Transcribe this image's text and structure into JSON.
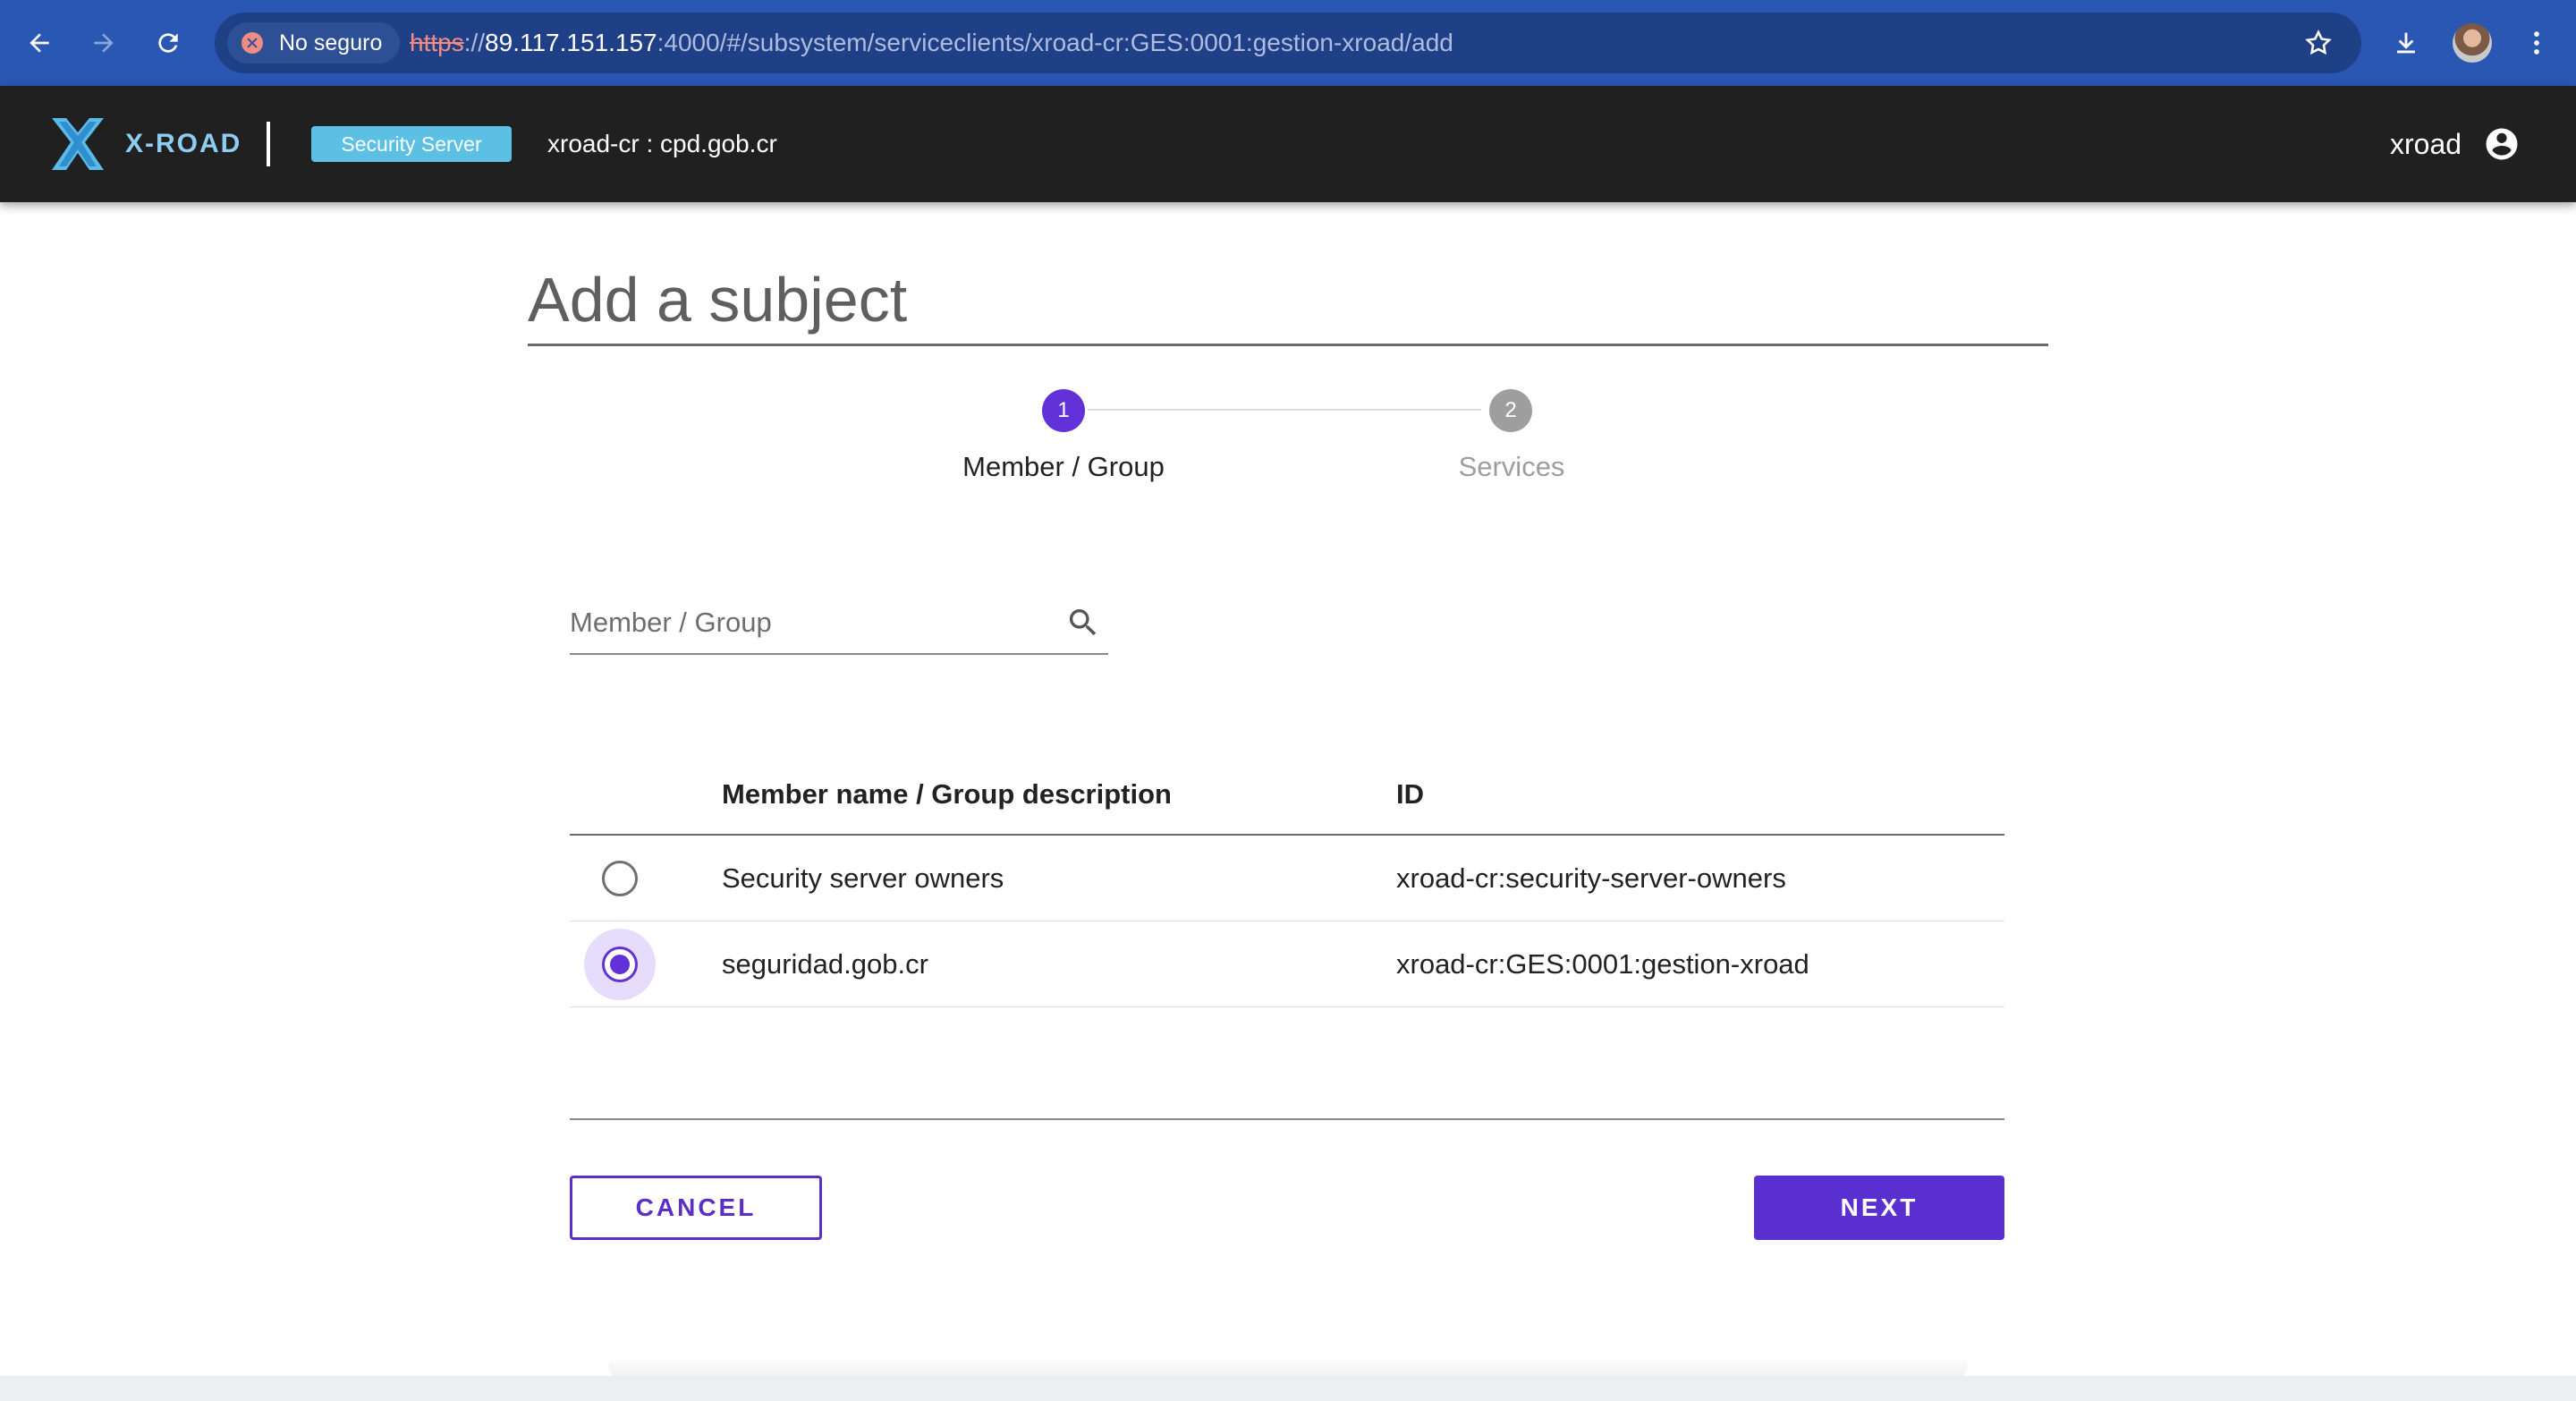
{
  "browser": {
    "security_label": "No seguro",
    "url_protocol": "https",
    "url_separator": "://",
    "url_host": "89.117.151.157",
    "url_rest": ":4000/#/subsystem/serviceclients/xroad-cr:GES:0001:gestion-xroad/add"
  },
  "header": {
    "logo_text": "X-ROAD",
    "server_badge": "Security Server",
    "server_id": "xroad-cr : cpd.gob.cr",
    "user": "xroad"
  },
  "page": {
    "title": "Add a subject"
  },
  "stepper": {
    "steps": [
      {
        "number": "1",
        "label": "Member / Group",
        "state": "active"
      },
      {
        "number": "2",
        "label": "Services",
        "state": "inactive"
      }
    ]
  },
  "search": {
    "placeholder": "Member / Group",
    "value": ""
  },
  "table": {
    "columns": [
      "Member name / Group description",
      "ID"
    ],
    "rows": [
      {
        "name": "Security server owners",
        "id": "xroad-cr:security-server-owners",
        "selected": false
      },
      {
        "name": "seguridad.gob.cr",
        "id": "xroad-cr:GES:0001:gestion-xroad",
        "selected": true
      }
    ]
  },
  "actions": {
    "cancel": "CANCEL",
    "next": "NEXT"
  },
  "colors": {
    "accent": "#6331d8",
    "header_bg": "#202020",
    "browser_bar": "#2b57b4",
    "badge": "#5bc0e3"
  },
  "icons": [
    "back-arrow-icon",
    "forward-arrow-icon",
    "reload-icon",
    "not-secure-icon",
    "bookmark-star-icon",
    "download-icon",
    "kebab-menu-icon",
    "x-road-logo",
    "account-circle-icon",
    "search-icon"
  ]
}
